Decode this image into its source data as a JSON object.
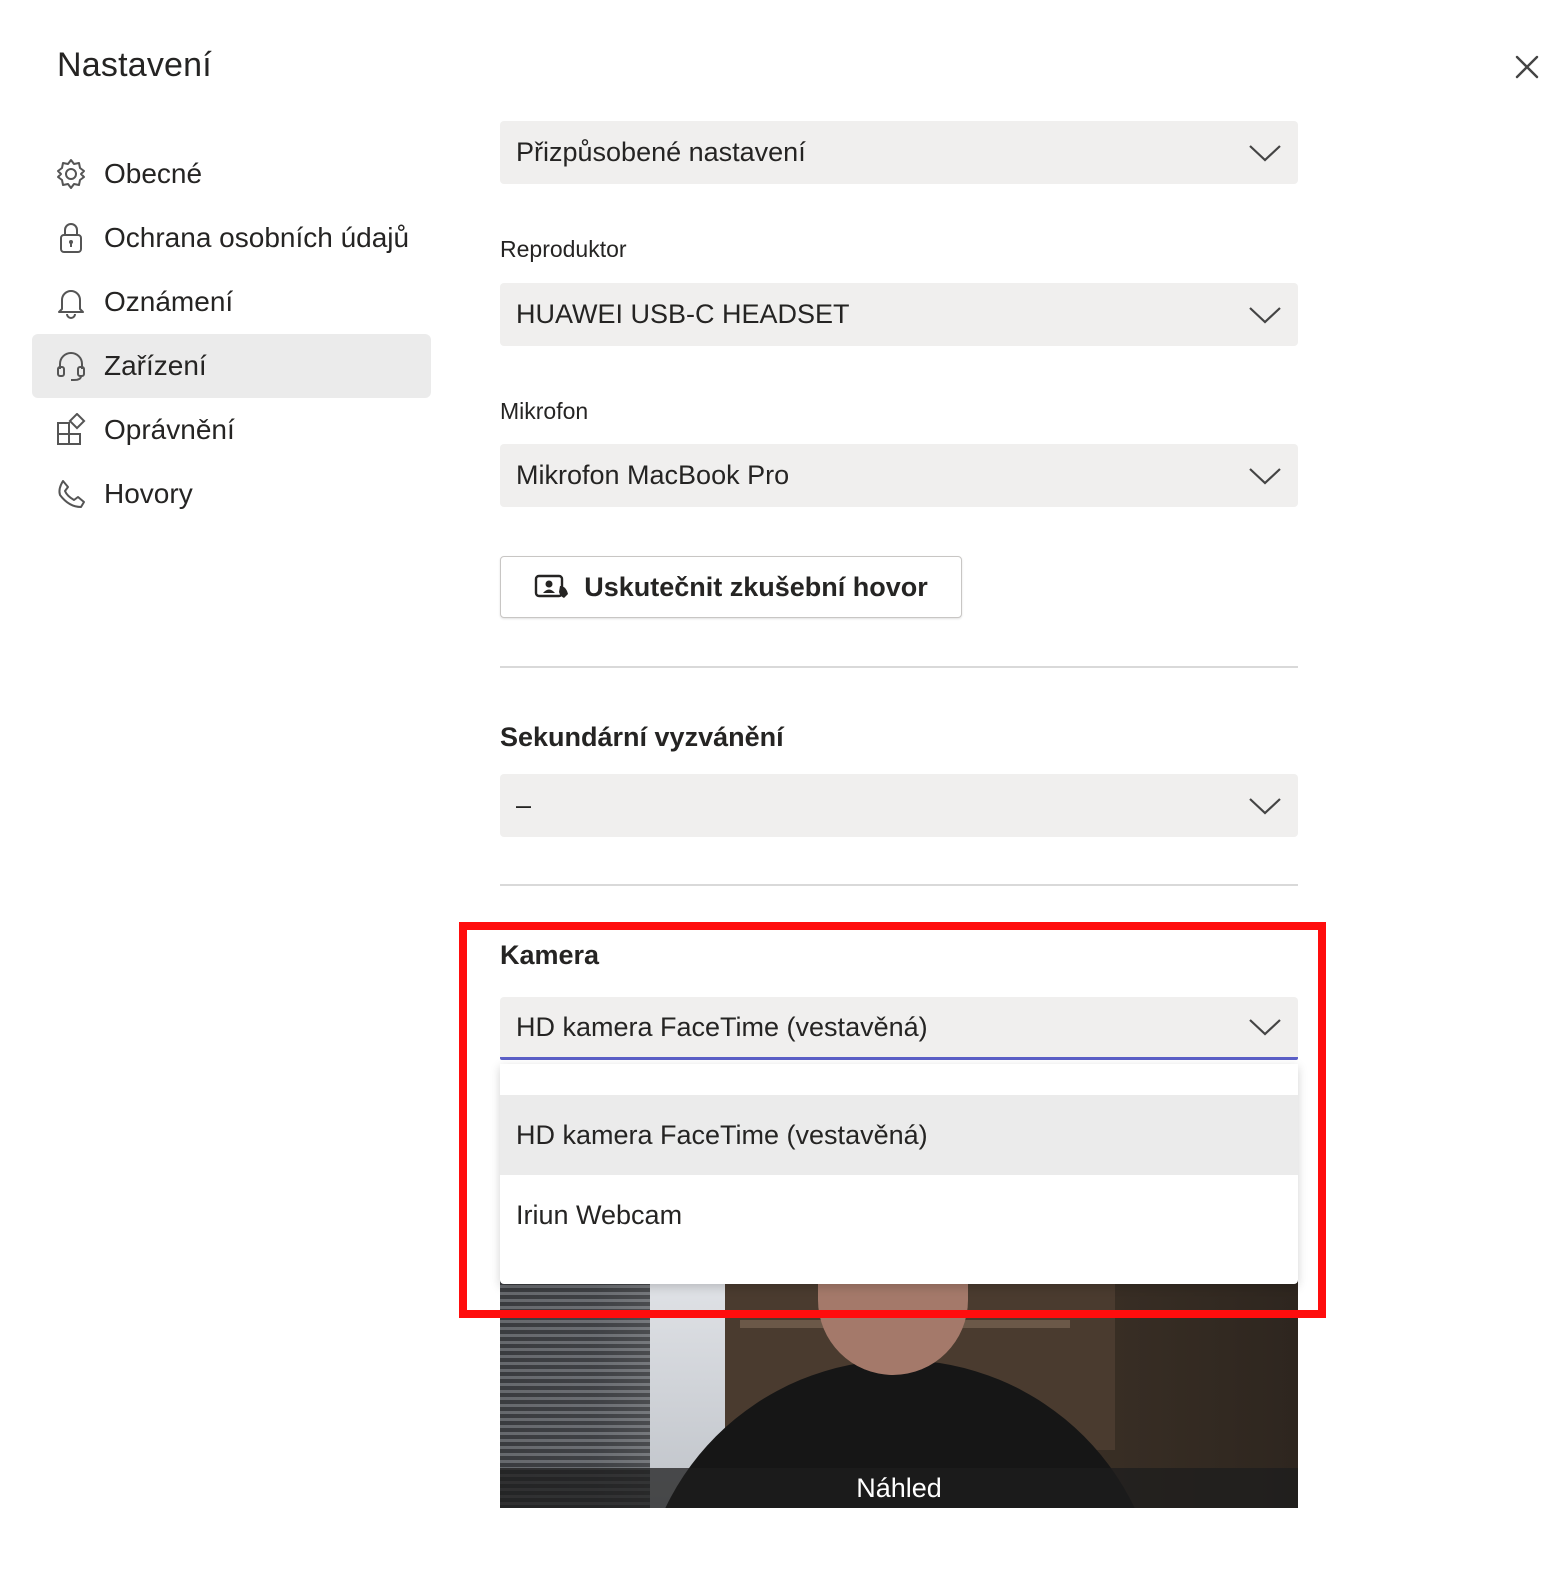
{
  "dialog": {
    "title": "Nastavení",
    "close_icon": "close-icon"
  },
  "sidebar": {
    "items": [
      {
        "label": "Obecné",
        "icon": "gear-icon",
        "active": false
      },
      {
        "label": "Ochrana osobních údajů",
        "icon": "lock-icon",
        "active": false
      },
      {
        "label": "Oznámení",
        "icon": "bell-icon",
        "active": false
      },
      {
        "label": "Zařízení",
        "icon": "headset-icon",
        "active": true
      },
      {
        "label": "Oprávnění",
        "icon": "apps-icon",
        "active": false
      },
      {
        "label": "Hovory",
        "icon": "phone-icon",
        "active": false
      }
    ]
  },
  "devices": {
    "audio_preset": {
      "value": "Přizpůsobené nastavení"
    },
    "speaker": {
      "label": "Reproduktor",
      "value": "HUAWEI USB-C HEADSET"
    },
    "microphone": {
      "label": "Mikrofon",
      "value": "Mikrofon MacBook Pro"
    },
    "test_call_button": "Uskutečnit zkušební hovor",
    "secondary_ringer": {
      "label": "Sekundární vyzvánění",
      "value": "–"
    },
    "camera": {
      "label": "Kamera",
      "value": "HD kamera FaceTime (vestavěná)",
      "options": [
        "HD kamera FaceTime (vestavěná)",
        "Iriun Webcam"
      ],
      "selected_index": 0
    },
    "preview_caption": "Náhled"
  },
  "colors": {
    "highlight_border": "#ff0d0d",
    "focus_underline": "#5b5fc7",
    "select_bg": "#f0efee",
    "active_nav_bg": "#ebebeb"
  }
}
